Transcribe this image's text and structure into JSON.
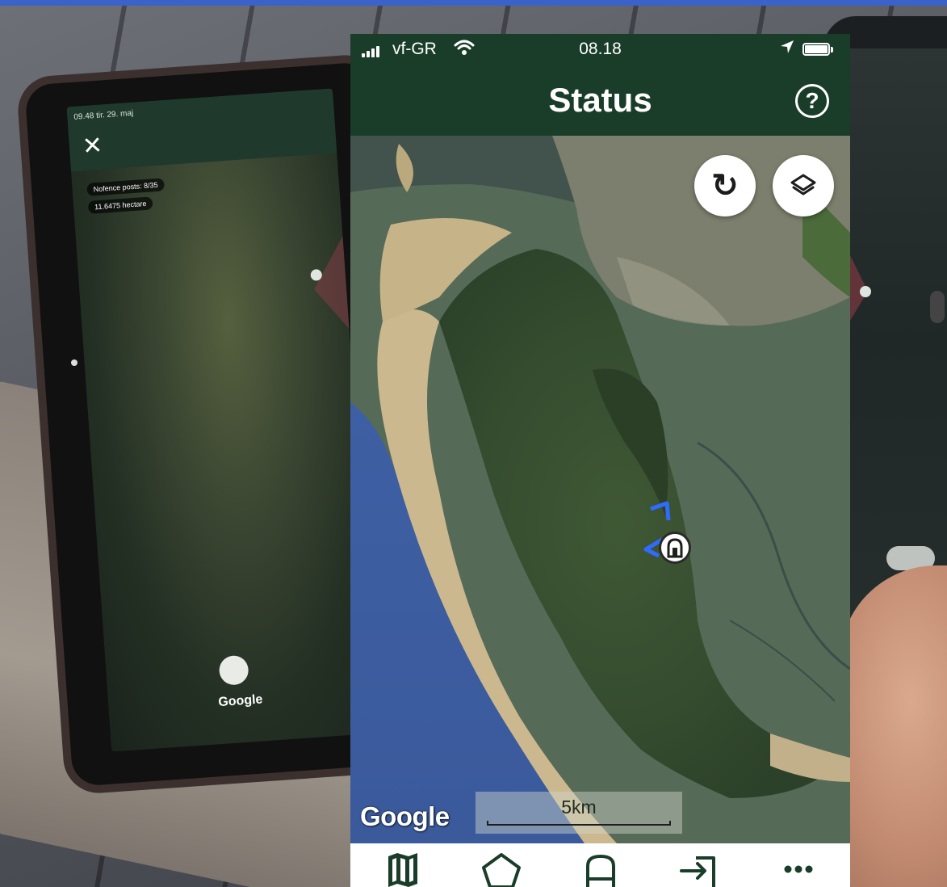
{
  "status_bar": {
    "carrier": "vf-GR",
    "time": "08.18"
  },
  "header": {
    "title": "Status",
    "help_icon_label": "?"
  },
  "map": {
    "refresh_icon": "↻",
    "provider_logo": "Google",
    "scale_label": "5km"
  },
  "tab_bar": {
    "tabs": [
      {
        "name": "tab-map",
        "icon": "map-icon",
        "active": true
      },
      {
        "name": "tab-polygon",
        "icon": "pentagon-icon",
        "active": false
      },
      {
        "name": "tab-posts",
        "icon": "fence-post-icon",
        "active": false
      },
      {
        "name": "tab-import",
        "icon": "import-icon",
        "active": false
      },
      {
        "name": "tab-more",
        "icon": "more-icon",
        "active": false
      }
    ]
  },
  "background_tablet": {
    "time": "09.48 tir. 29. maj",
    "badge_posts": "Nofence posts: 8/35",
    "badge_area": "11.6475 hectare",
    "logo": "Google"
  },
  "colors": {
    "brand_green": "#1a3d2a",
    "tab_bar_bg": "#ffffff",
    "marker_blue": "#2f6bff",
    "accent_top_line": "#3a62c9"
  }
}
